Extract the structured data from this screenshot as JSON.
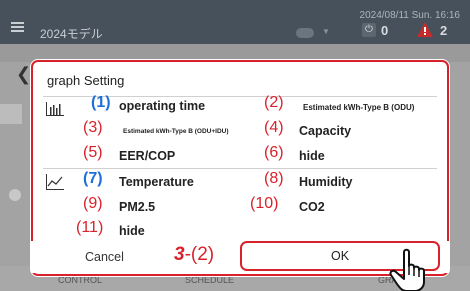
{
  "header": {
    "model": "2024モデル",
    "datetime": "2024/08/11 Sun. 16:16",
    "power_count": "0",
    "alert_count": "2",
    "power_icon": "power-icon",
    "alert_icon": "warning-icon"
  },
  "footer": {
    "tab_control": "CONTROL",
    "tab_schedule": "SCHEDULE",
    "tab_graph": "GRAPH"
  },
  "dialog": {
    "title": "graph Setting",
    "bar_chart_icon": "bar-chart-icon",
    "line_chart_icon": "line-chart-icon",
    "options": [
      {
        "num": "(1)",
        "label": "operating time"
      },
      {
        "num": "(2)",
        "label": "Estimated kWh-Type B (ODU)"
      },
      {
        "num": "(3)",
        "label": "Estimated kWh-Type B (ODU+IDU)"
      },
      {
        "num": "(4)",
        "label": "Capacity"
      },
      {
        "num": "(5)",
        "label": "EER/COP"
      },
      {
        "num": "(6)",
        "label": "hide"
      },
      {
        "num": "(7)",
        "label": "Temperature"
      },
      {
        "num": "(8)",
        "label": "Humidity"
      },
      {
        "num": "(9)",
        "label": "PM2.5"
      },
      {
        "num": "(10)",
        "label": "CO2"
      },
      {
        "num": "(11)",
        "label": "hide"
      }
    ],
    "cancel_label": "Cancel",
    "ok_label": "OK",
    "step_num": "3",
    "step_sub": "-(2)"
  },
  "colors": {
    "accent_red": "#d8222b",
    "accent_blue": "#1e6fd9",
    "header_bg": "#46515c"
  }
}
